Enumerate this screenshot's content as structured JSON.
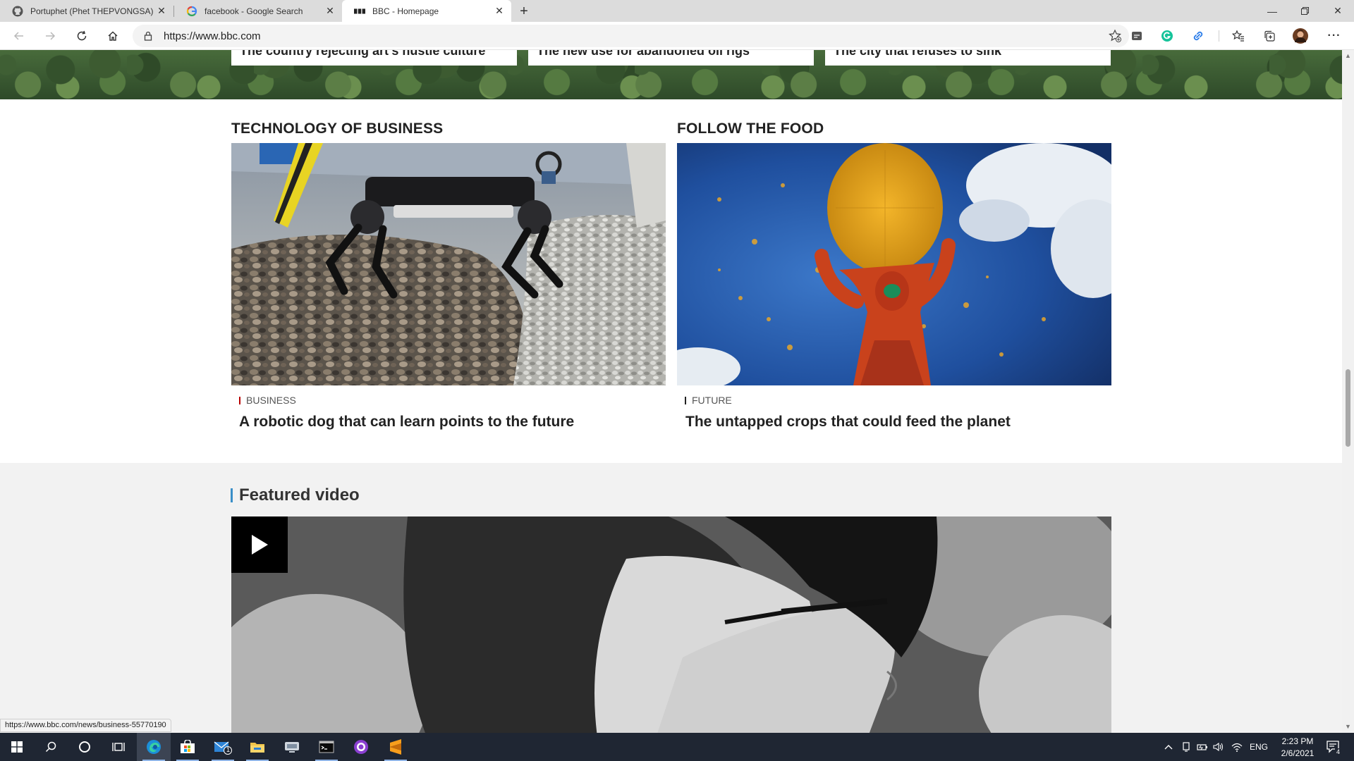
{
  "browser": {
    "tabs": [
      {
        "title": "Portuphet (Phet THEPVONGSA)",
        "favicon": "github-icon",
        "active": false
      },
      {
        "title": "facebook - Google Search",
        "favicon": "google-icon",
        "active": false
      },
      {
        "title": "BBC - Homepage",
        "favicon": "bbc-icon",
        "active": true
      }
    ],
    "address": {
      "url": "https://www.bbc.com"
    },
    "status_url": "https://www.bbc.com/news/business-55770190"
  },
  "page": {
    "top_cards": [
      {
        "headline": "The country rejecting art's hustle culture"
      },
      {
        "headline": "The new use for abandoned oil rigs"
      },
      {
        "headline": "The city that refuses to sink"
      }
    ],
    "sections": [
      {
        "title": "TECHNOLOGY OF BUSINESS",
        "tag": "BUSINESS",
        "tag_color": "#b80000",
        "headline": "A robotic dog that can learn points to the future",
        "image": "robot-dog-photo"
      },
      {
        "title": "FOLLOW THE FOOD",
        "tag": "FUTURE",
        "tag_color": "#222222",
        "headline": "The untapped crops that could feed the planet",
        "image": "woman-sifting-grain-photo"
      }
    ],
    "featured_video": {
      "title": "Featured video",
      "accent": "#3a8fc8"
    }
  },
  "taskbar": {
    "lang": "ENG",
    "time": "2:23 PM",
    "date": "2/6/2021",
    "notifications": "4",
    "mail_badge": "1"
  }
}
